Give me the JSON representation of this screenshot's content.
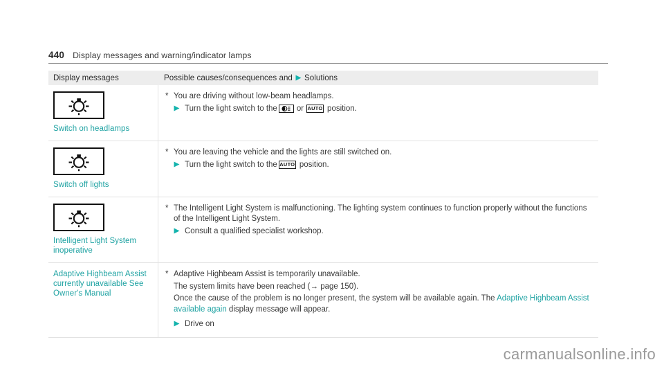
{
  "page": {
    "number": "440",
    "title": "Display messages and warning/indicator lamps",
    "watermark": "carmanualsonline.info"
  },
  "colors": {
    "teal": "#20a3a3",
    "header_bg": "#ededed",
    "text": "#3a3a3a",
    "rule": "#8d8d8d"
  },
  "table": {
    "headers": {
      "left": "Display messages",
      "right_before": "Possible causes/consequences and",
      "right_marker": "solution-triangle-icon",
      "right_after": "Solutions"
    },
    "rows": [
      {
        "icon": "headlamp-bulb-icon",
        "message": "Switch on headlamps",
        "cause": "You are driving without low-beam headlamps.",
        "actions": [
          {
            "prefix": "Turn the light switch to the",
            "symbol1": "low-beam-switch-icon",
            "middle": "or",
            "symbol2": "AUTO",
            "suffix": "position."
          }
        ],
        "notes": []
      },
      {
        "icon": "headlamp-bulb-icon",
        "message": "Switch off lights",
        "cause": "You are leaving the vehicle and the lights are still switched on.",
        "actions": [
          {
            "prefix": "Turn the light switch to the",
            "symbol1": null,
            "middle": "",
            "symbol2": "AUTO",
            "suffix": "position."
          }
        ],
        "notes": []
      },
      {
        "icon": "headlamp-bulb-icon",
        "message": "Intelligent Light System inoperative",
        "cause": "The Intelligent Light System is malfunctioning. The lighting system continues to function properly without the functions of the Intelligent Light System.",
        "actions": [
          {
            "prefix": "Consult a qualified specialist workshop.",
            "symbol1": null,
            "middle": "",
            "symbol2": null,
            "suffix": ""
          }
        ],
        "notes": []
      },
      {
        "icon": null,
        "message": "Adaptive Highbeam Assist currently unavailable See Owner's Manual",
        "cause": "Adaptive Highbeam Assist is temporarily unavailable.",
        "notes": [
          "The system limits have been reached (→ page 150).",
          "Once the cause of the problem is no longer present, the system will be available again. The "
        ],
        "note_link": "Adaptive Highbeam Assist available again",
        "note_tail": " display message will appear.",
        "actions": [
          {
            "prefix": "Drive on",
            "symbol1": null,
            "middle": "",
            "symbol2": null,
            "suffix": ""
          }
        ]
      }
    ]
  }
}
